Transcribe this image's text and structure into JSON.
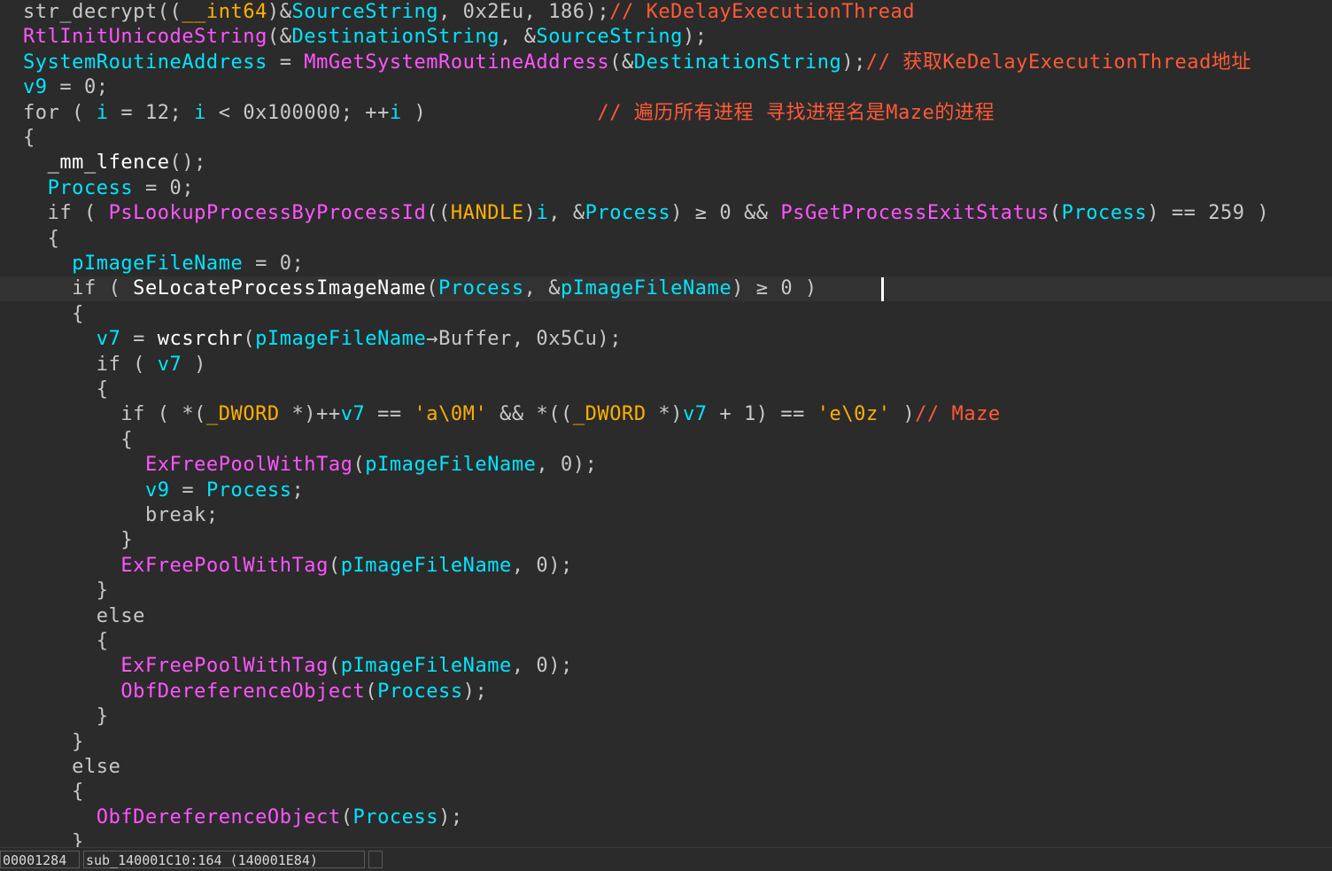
{
  "window": {
    "view": "pseudocode"
  },
  "colors": {
    "background": "#2b2b2b",
    "function": "#ff55ff",
    "variable": "#00e5ff",
    "comment": "#ff5a36",
    "string": "#ffb000",
    "plain": "#c8c8c8"
  },
  "code": {
    "lines": [
      [
        [
          "plain",
          "str_decrypt(("
        ],
        [
          "type",
          "__int64"
        ],
        [
          "plain",
          ")&"
        ],
        [
          "var",
          "SourceString"
        ],
        [
          "plain",
          ", 0x2Eu, 186);"
        ],
        [
          "cmt",
          "// KeDelayExecutionThread"
        ]
      ],
      [
        [
          "func",
          "RtlInitUnicodeString"
        ],
        [
          "plain",
          "(&"
        ],
        [
          "var",
          "DestinationString"
        ],
        [
          "plain",
          ", &"
        ],
        [
          "var",
          "SourceString"
        ],
        [
          "plain",
          ");"
        ]
      ],
      [
        [
          "var",
          "SystemRoutineAddress"
        ],
        [
          "plain",
          " = "
        ],
        [
          "func",
          "MmGetSystemRoutineAddress"
        ],
        [
          "plain",
          "(&"
        ],
        [
          "var",
          "DestinationString"
        ],
        [
          "plain",
          ");"
        ],
        [
          "cmt",
          "// 获取KeDelayExecutionThread地址"
        ]
      ],
      [
        [
          "var",
          "v9"
        ],
        [
          "plain",
          " = 0;"
        ]
      ],
      [
        [
          "plain",
          "for ( "
        ],
        [
          "var",
          "i"
        ],
        [
          "plain",
          " = 12; "
        ],
        [
          "var",
          "i"
        ],
        [
          "plain",
          " < 0x100000; ++"
        ],
        [
          "var",
          "i"
        ],
        [
          "plain",
          " )              "
        ],
        [
          "cmt",
          "// 遍历所有进程 寻找进程名是Maze的进程"
        ]
      ],
      [
        [
          "plain",
          "{"
        ]
      ],
      [
        [
          "plain",
          "  "
        ],
        [
          "lbl",
          "_mm_lfence"
        ],
        [
          "plain",
          "();"
        ]
      ],
      [
        [
          "plain",
          "  "
        ],
        [
          "var",
          "Process"
        ],
        [
          "plain",
          " = 0;"
        ]
      ],
      [
        [
          "plain",
          "  if ( "
        ],
        [
          "func",
          "PsLookupProcessByProcessId"
        ],
        [
          "plain",
          "(("
        ],
        [
          "type",
          "HANDLE"
        ],
        [
          "plain",
          ")"
        ],
        [
          "var",
          "i"
        ],
        [
          "plain",
          ", &"
        ],
        [
          "var",
          "Process"
        ],
        [
          "plain",
          ") ≥ 0 && "
        ],
        [
          "func",
          "PsGetProcessExitStatus"
        ],
        [
          "plain",
          "("
        ],
        [
          "var",
          "Process"
        ],
        [
          "plain",
          ") == 259 )"
        ]
      ],
      [
        [
          "plain",
          "  {"
        ]
      ],
      [
        [
          "plain",
          "    "
        ],
        [
          "var",
          "pImageFileName"
        ],
        [
          "plain",
          " = 0;"
        ]
      ],
      [
        [
          "plain",
          "    if ( "
        ],
        [
          "lbl",
          "SeLocateProcessImageName"
        ],
        [
          "plain",
          "("
        ],
        [
          "var",
          "Process"
        ],
        [
          "plain",
          ", &"
        ],
        [
          "var",
          "pImageFileName"
        ],
        [
          "plain",
          ") ≥ 0 )"
        ]
      ],
      [
        [
          "plain",
          "    {"
        ]
      ],
      [
        [
          "plain",
          "      "
        ],
        [
          "var",
          "v7"
        ],
        [
          "plain",
          " = "
        ],
        [
          "lbl",
          "wcsrchr"
        ],
        [
          "plain",
          "("
        ],
        [
          "var",
          "pImageFileName"
        ],
        [
          "plain",
          "→Buffer, 0x5Cu);"
        ]
      ],
      [
        [
          "plain",
          "      if ( "
        ],
        [
          "var",
          "v7"
        ],
        [
          "plain",
          " )"
        ]
      ],
      [
        [
          "plain",
          "      {"
        ]
      ],
      [
        [
          "plain",
          "        if ( *("
        ],
        [
          "type",
          "_DWORD"
        ],
        [
          "plain",
          " *)++"
        ],
        [
          "var",
          "v7"
        ],
        [
          "plain",
          " == "
        ],
        [
          "str",
          "'a\\0M'"
        ],
        [
          "plain",
          " && *(("
        ],
        [
          "type",
          "_DWORD"
        ],
        [
          "plain",
          " *)"
        ],
        [
          "var",
          "v7"
        ],
        [
          "plain",
          " + 1) == "
        ],
        [
          "str",
          "'e\\0z'"
        ],
        [
          "plain",
          " )"
        ],
        [
          "cmt",
          "// Maze"
        ]
      ],
      [
        [
          "plain",
          "        {"
        ]
      ],
      [
        [
          "plain",
          "          "
        ],
        [
          "func",
          "ExFreePoolWithTag"
        ],
        [
          "plain",
          "("
        ],
        [
          "var",
          "pImageFileName"
        ],
        [
          "plain",
          ", 0);"
        ]
      ],
      [
        [
          "plain",
          "          "
        ],
        [
          "var",
          "v9"
        ],
        [
          "plain",
          " = "
        ],
        [
          "var",
          "Process"
        ],
        [
          "plain",
          ";"
        ]
      ],
      [
        [
          "plain",
          "          break;"
        ]
      ],
      [
        [
          "plain",
          "        }"
        ]
      ],
      [
        [
          "plain",
          "        "
        ],
        [
          "func",
          "ExFreePoolWithTag"
        ],
        [
          "plain",
          "("
        ],
        [
          "var",
          "pImageFileName"
        ],
        [
          "plain",
          ", 0);"
        ]
      ],
      [
        [
          "plain",
          "      }"
        ]
      ],
      [
        [
          "plain",
          "      else"
        ]
      ],
      [
        [
          "plain",
          "      {"
        ]
      ],
      [
        [
          "plain",
          "        "
        ],
        [
          "func",
          "ExFreePoolWithTag"
        ],
        [
          "plain",
          "("
        ],
        [
          "var",
          "pImageFileName"
        ],
        [
          "plain",
          ", 0);"
        ]
      ],
      [
        [
          "plain",
          "        "
        ],
        [
          "func",
          "ObfDereferenceObject"
        ],
        [
          "plain",
          "("
        ],
        [
          "var",
          "Process"
        ],
        [
          "plain",
          ");"
        ]
      ],
      [
        [
          "plain",
          "      }"
        ]
      ],
      [
        [
          "plain",
          "    }"
        ]
      ],
      [
        [
          "plain",
          "    else"
        ]
      ],
      [
        [
          "plain",
          "    {"
        ]
      ],
      [
        [
          "plain",
          "      "
        ],
        [
          "func",
          "ObfDereferenceObject"
        ],
        [
          "plain",
          "("
        ],
        [
          "var",
          "Process"
        ],
        [
          "plain",
          ");"
        ]
      ],
      [
        [
          "plain",
          "    }"
        ]
      ]
    ],
    "current_line": 11
  },
  "statusbar": {
    "offset": "00001284",
    "location": "sub_140001C10:164 (140001E84)",
    "extra": ""
  }
}
